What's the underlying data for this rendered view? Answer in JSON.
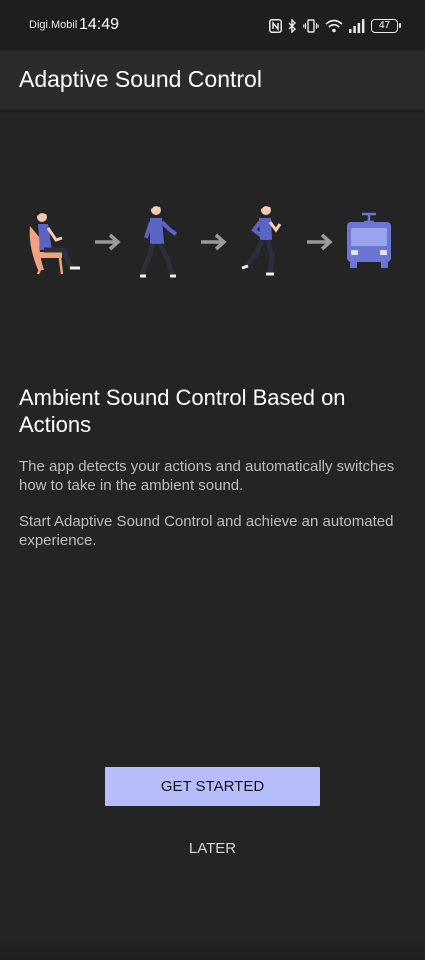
{
  "status_bar": {
    "carrier": "Digi.Mobil",
    "time": "14:49",
    "battery_level": "47",
    "icons": [
      "nfc-icon",
      "bluetooth-icon",
      "vibrate-icon",
      "wifi-icon",
      "signal-icon",
      "battery-icon"
    ]
  },
  "app_bar": {
    "title": "Adaptive Sound Control"
  },
  "illustration": {
    "steps": [
      "sitting",
      "walking",
      "running",
      "transport"
    ],
    "arrow_icon": "arrow-right-icon",
    "colors": {
      "person_shirt": "#5b64c4",
      "chair": "#f2a27e",
      "bus": "#6c74d4",
      "arrow": "#9a9a9a"
    }
  },
  "content": {
    "headline": "Ambient Sound Control Based on Actions",
    "paragraph_1": "The app detects your actions and automatically switches how to take in the ambient sound.",
    "paragraph_2": "Start Adaptive Sound Control and achieve an automated experience."
  },
  "actions": {
    "primary_label": "GET STARTED",
    "secondary_label": "LATER"
  },
  "colors": {
    "background": "#242424",
    "app_bar": "#2b2b2b",
    "primary_button": "#b7bdfb",
    "body_text": "#bdbdbd"
  }
}
